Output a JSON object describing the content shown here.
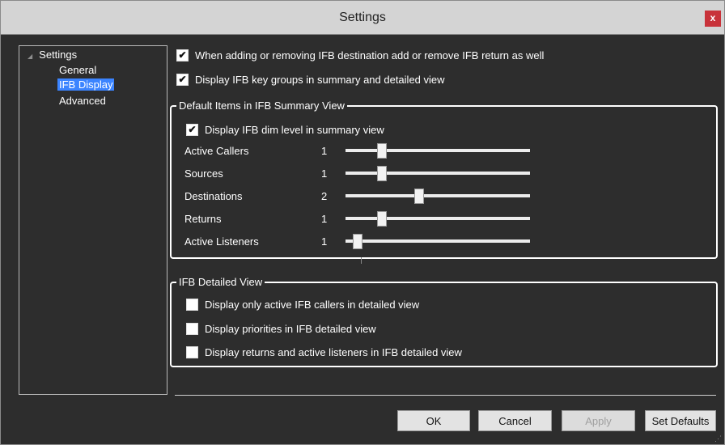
{
  "window": {
    "title": "Settings",
    "close_glyph": "x"
  },
  "tree": {
    "root": "Settings",
    "items": [
      {
        "label": "General",
        "selected": false
      },
      {
        "label": "IFB Display",
        "selected": true
      },
      {
        "label": "Advanced",
        "selected": false
      }
    ]
  },
  "options": [
    {
      "label": "When adding or removing IFB destination add or remove IFB return as well",
      "checked": true
    },
    {
      "label": "Display IFB key groups in summary and detailed view",
      "checked": true
    }
  ],
  "summary_group": {
    "legend": "Default Items in IFB Summary View",
    "dim_checkbox": {
      "label": "Display IFB dim level in summary view",
      "checked": true
    },
    "sliders": [
      {
        "label": "Active Callers",
        "value": "1",
        "position": 0.2
      },
      {
        "label": "Sources",
        "value": "1",
        "position": 0.2
      },
      {
        "label": "Destinations",
        "value": "2",
        "position": 0.4
      },
      {
        "label": "Returns",
        "value": "1",
        "position": 0.2
      },
      {
        "label": "Active Listeners",
        "value": "1",
        "position": 0.06
      }
    ]
  },
  "detailed_group": {
    "legend": "IFB Detailed View",
    "checkboxes": [
      {
        "label": "Display only active IFB callers in detailed view",
        "checked": false
      },
      {
        "label": "Display priorities in IFB detailed view",
        "checked": false
      },
      {
        "label": "Display returns and active listeners in IFB detailed view",
        "checked": false
      }
    ]
  },
  "buttons": {
    "ok": "OK",
    "cancel": "Cancel",
    "apply": "Apply",
    "set_defaults": "Set Defaults"
  },
  "check_glyph": "✔",
  "colors": {
    "selection": "#3b84ff",
    "close": "#c8323a",
    "background": "#2d2d2d"
  }
}
